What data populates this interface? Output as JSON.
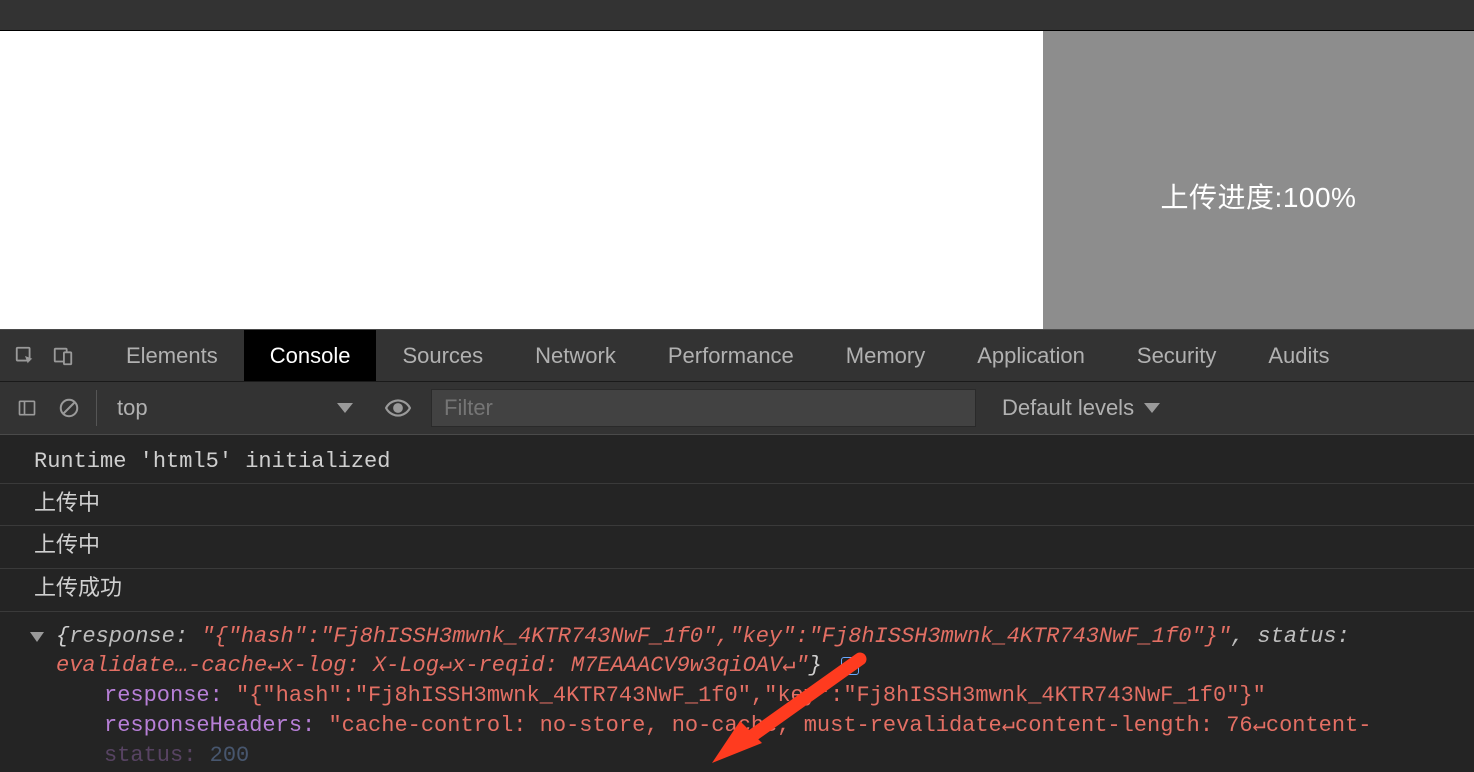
{
  "page": {
    "progress_label": "上传进度:100%"
  },
  "devtools": {
    "tabs": {
      "elements": "Elements",
      "console": "Console",
      "sources": "Sources",
      "network": "Network",
      "performance": "Performance",
      "memory": "Memory",
      "application": "Application",
      "security": "Security",
      "audits": "Audits"
    },
    "toolbar": {
      "context": "top",
      "filter_placeholder": "Filter",
      "levels_label": "Default levels"
    },
    "log": {
      "l1": "Runtime 'html5' initialized",
      "l2": "上传中",
      "l3": "上传中",
      "l4": "上传成功",
      "object_preview": {
        "line1_prefix": "{",
        "response_key": "response:",
        "response_str": "\"{\"hash\":\"Fj8hISSH3mwnk_4KTR743NwF_1f0\",\"key\":\"Fj8hISSH3mwnk_4KTR743NwF_1f0\"}\"",
        "status_key": ", status:",
        "line2_prefix": "evalidate…-cache↵x-log: X-Log↵x-reqid: M7EAAACV9w3qiOAV↵\"",
        "line2_brace": "}",
        "prop_response_key": "response:",
        "prop_response_val": "\"{\"hash\":\"Fj8hISSH3mwnk_4KTR743NwF_1f0\",\"key\":\"Fj8hISSH3mwnk_4KTR743NwF_1f0\"}\"",
        "prop_headers_key": "responseHeaders:",
        "prop_headers_val": "\"cache-control: no-store, no-cache, must-revalidate↵content-length: 76↵content-",
        "prop_status_key": "status:",
        "prop_status_val": "200"
      }
    }
  }
}
